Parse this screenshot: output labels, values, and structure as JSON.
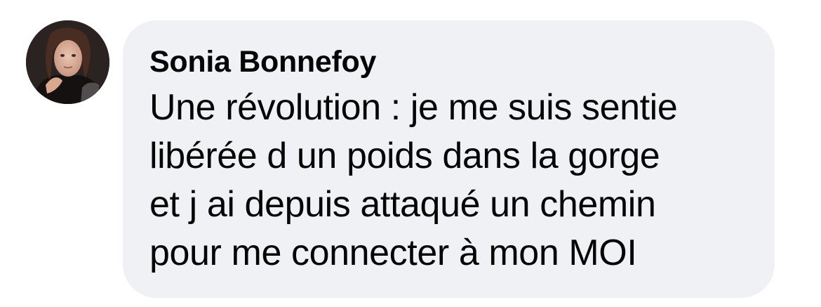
{
  "comment": {
    "author": "Sonia Bonnefoy",
    "avatar_icon": "user-avatar-photo",
    "lines": [
      "Une révolution : je me suis sentie",
      "libérée d un poids dans la gorge",
      "et j ai depuis attaqué un chemin",
      "pour me connecter à mon MOI"
    ]
  },
  "colors": {
    "bubble_background": "#f0f1f4",
    "text": "#050505",
    "page_background": "#ffffff"
  }
}
